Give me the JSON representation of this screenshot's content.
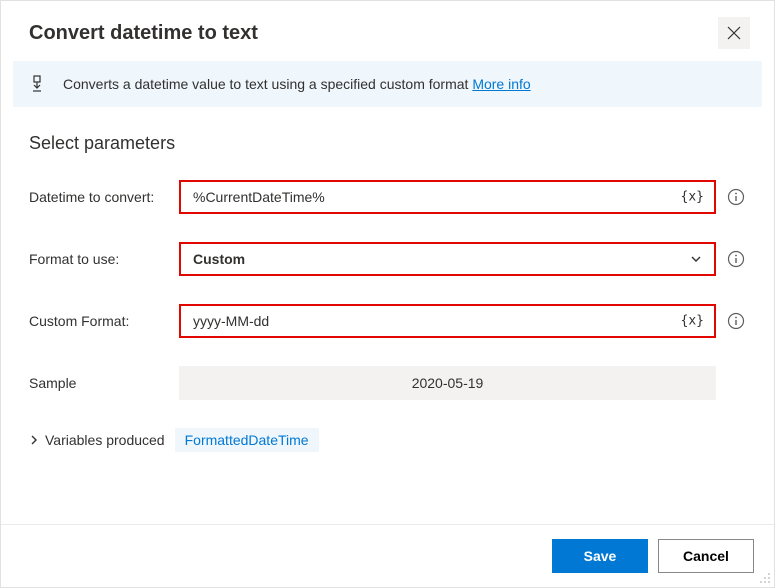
{
  "dialog": {
    "title": "Convert datetime to text",
    "description": "Converts a datetime value to text using a specified custom format",
    "more_info": "More info"
  },
  "section": {
    "title": "Select parameters"
  },
  "fields": {
    "datetime_label": "Datetime to convert:",
    "datetime_value": "%CurrentDateTime%",
    "format_label": "Format to use:",
    "format_value": "Custom",
    "custom_label": "Custom Format:",
    "custom_value": "yyyy-MM-dd",
    "sample_label": "Sample",
    "sample_value": "2020-05-19"
  },
  "variables": {
    "label": "Variables produced",
    "output": "FormattedDateTime"
  },
  "footer": {
    "save": "Save",
    "cancel": "Cancel"
  },
  "glyphs": {
    "var_token": "{x}"
  }
}
